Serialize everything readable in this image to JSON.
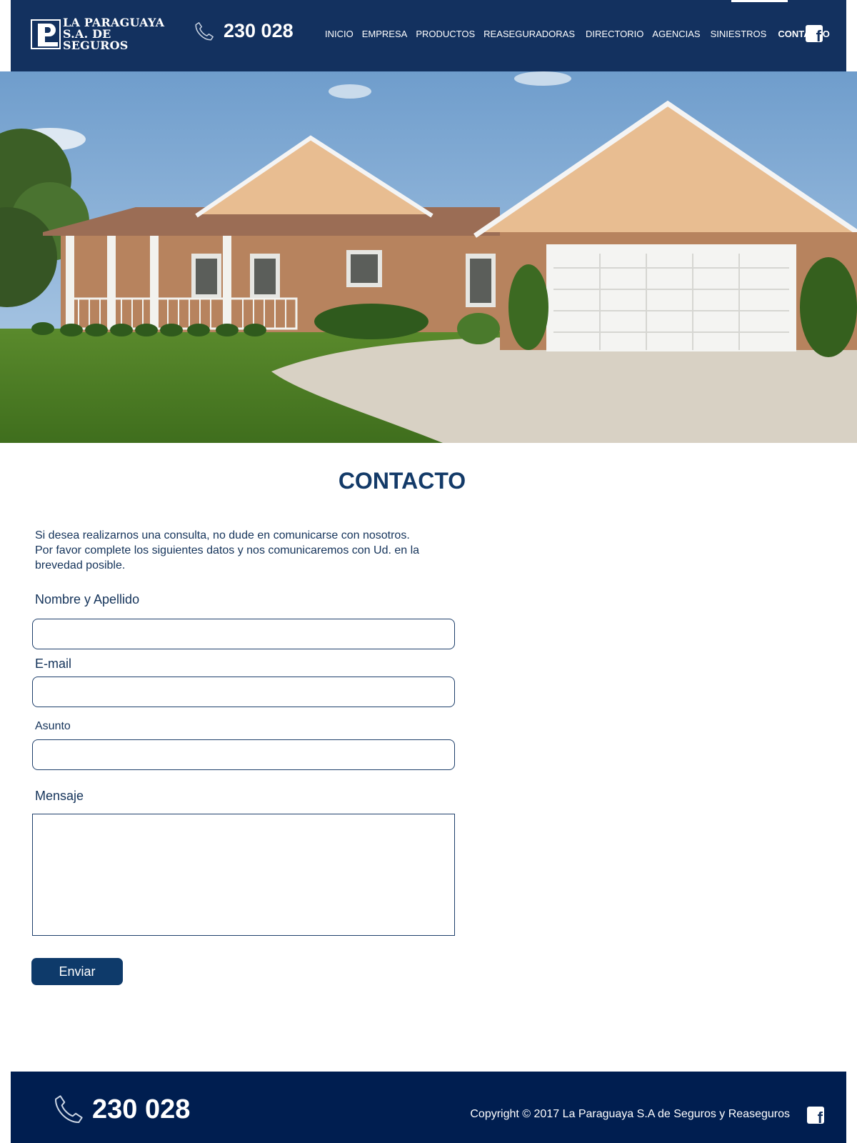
{
  "brand": {
    "line1": "LA PARAGUAYA",
    "line2": "S.A. DE SEGUROS"
  },
  "header": {
    "phone": "230 028"
  },
  "nav": {
    "items": [
      "INICIO",
      "EMPRESA",
      "PRODUCTOS",
      "REASEGURADORAS",
      "DIRECTORIO",
      "AGENCIAS",
      "SINIESTROS",
      "CONTACTO"
    ],
    "active": "CONTACTO"
  },
  "icons": {
    "phone": "phone-icon",
    "facebook": "facebook-icon"
  },
  "hero": {
    "image": "house-with-garage-photo"
  },
  "contact": {
    "title": "CONTACTO",
    "intro": "Si desea realizarnos una consulta, no dude en comunicarse con nosotros. Por favor complete los siguientes datos y nos comunicaremos con Ud. en la brevedad posible.",
    "fields": {
      "name_label": "Nombre y Apellido",
      "email_label": "E-mail",
      "subject_label": "Asunto",
      "message_label": "Mensaje"
    },
    "submit_label": "Enviar"
  },
  "footer": {
    "phone": "230 028",
    "copyright": "Copyright © 2017 La Paraguaya S.A de Seguros y Reaseguros"
  },
  "colors": {
    "header_bg": "#13315f",
    "footer_bg": "#001e50",
    "accent": "#0e3a6a",
    "text": "#14335a"
  }
}
